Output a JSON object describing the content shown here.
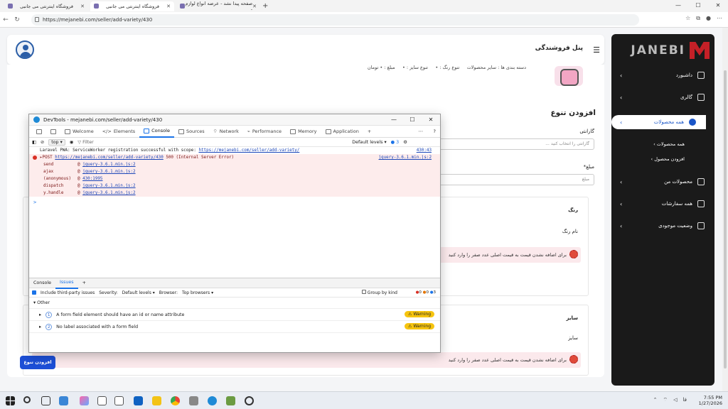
{
  "browser": {
    "tabs": [
      {
        "title": "فروشگاه اینترنتی می جانبی",
        "active": false
      },
      {
        "title": "فروشگاه اینترنتی می جانبی",
        "active": true
      },
      {
        "title": "صفحه پیدا نشد - عرضه انواع لوازم -",
        "active": false
      }
    ],
    "new_tab": "+",
    "url": "https://mejanebi.com/seller/add-variety/430"
  },
  "header": {
    "title": "پنل فروشندگی"
  },
  "sidebar": {
    "logo": "JANEBI",
    "items": [
      {
        "label": "داشبورد"
      },
      {
        "label": "گالری"
      },
      {
        "label": "همه محصولات",
        "active": true
      },
      {
        "label": "محصولات من"
      },
      {
        "label": "همه سفارشات"
      },
      {
        "label": "وضعیت موجودی"
      }
    ],
    "subitems": [
      "همه محصولات",
      "افزودن محصول"
    ]
  },
  "product": {
    "category": "دسته بندی ها : سایر محصولات",
    "color_var": "تنوع رنگ : •",
    "size_var": "تنوع سایز : •",
    "price": "مبلغ : • تومان"
  },
  "form": {
    "heading": "افزودن تنوع",
    "guarantee_label": "گارانتی",
    "guarantee_placeholder": "گارانتی را انتخاب کنید ...",
    "price_label": "مبلغ*",
    "price_placeholder": "مبلغ",
    "color_section": "رنگ",
    "color_name": "نام رنگ",
    "size_section": "سایز",
    "size_name": "سایز",
    "error_msg": "برای اضافه نشدن قیمت به قیمت اصلی عدد صفر را وارد کنید",
    "submit": "افزودن تنوع"
  },
  "devtools": {
    "title": "DevTools - mejanebi.com/seller/add-variety/430",
    "tabs": [
      "Welcome",
      "Elements",
      "Console",
      "Sources",
      "Network",
      "Performance",
      "Memory",
      "Application"
    ],
    "active_tab": "Console",
    "context": "top",
    "filter": "Filter",
    "levels": "Default levels",
    "issues_count": "3",
    "log1": "Laravel PWA: ServiceWorker registration successful with scope: ",
    "log1_link": "https://mejanebi.com/seller/add-variety/",
    "log1_src": "430:43",
    "err_prefix": "▸POST ",
    "err_link": "https://mejanebi.com/seller/add-variety/430",
    "err_status": " 500 (Internal Server Error)",
    "err_src": "jquery-3.6.1.min.js:2",
    "stack": [
      {
        "fn": "send",
        "at": "@ ",
        "src": "jquery-3.6.1.min.js:2"
      },
      {
        "fn": "ajax",
        "at": "@ ",
        "src": "jquery-3.6.1.min.js:2"
      },
      {
        "fn": "(anonymous)",
        "at": "@ ",
        "src": "430:1995"
      },
      {
        "fn": "dispatch",
        "at": "@ ",
        "src": "jquery-3.6.1.min.js:2"
      },
      {
        "fn": "y.handle",
        "at": "@ ",
        "src": "jquery-3.6.1.min.js:2"
      }
    ],
    "prompt": ">",
    "drawer_tabs": [
      "Console",
      "Issues"
    ],
    "include_third_party": "Include third-party issues",
    "severity": "Severity:",
    "severity_val": "Default levels",
    "browser_lbl": "Browser:",
    "browser_val": "Top browsers",
    "group_by_kind": "Group by kind",
    "counts": [
      "0",
      "0",
      "3"
    ],
    "group": "Other",
    "issues": [
      {
        "n": "1",
        "text": "A form field element should have an id or name attribute",
        "badge": "Warning"
      },
      {
        "n": "2",
        "text": "No label associated with a form field",
        "badge": "Warning"
      }
    ]
  },
  "taskbar": {
    "time": "7:55 PM",
    "date": "1/27/2026",
    "lang": "فا"
  }
}
